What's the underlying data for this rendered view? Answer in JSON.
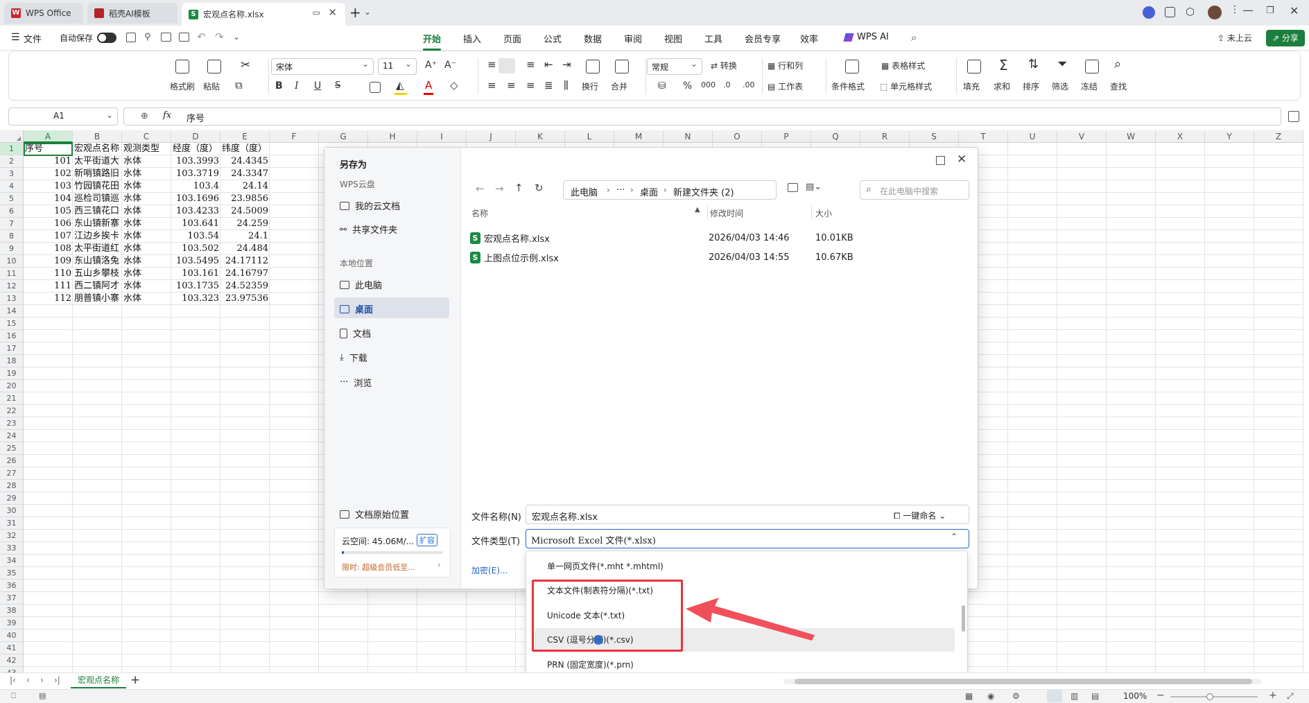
{
  "tabs": [
    {
      "label": "WPS Office",
      "color": "#c8262c"
    },
    {
      "label": "稻壳AI模板",
      "color": "#b6232a"
    },
    {
      "label": "宏观点名称.xlsx",
      "color": "#1a8a43"
    }
  ],
  "menubar": {
    "file": "文件",
    "autosave": "自动保存",
    "items": [
      "开始",
      "插入",
      "页面",
      "公式",
      "数据",
      "审阅",
      "视图",
      "工具",
      "会员专享",
      "效率",
      "WPS AI"
    ],
    "active": "开始",
    "cloud": "未上云",
    "share": "分享"
  },
  "ribbon": {
    "format_painter": "格式刷",
    "paste": "粘贴",
    "font": "宋体",
    "font_size": "11",
    "bold": "B",
    "italic": "I",
    "underline": "U",
    "wrap": "换行",
    "merge": "合并",
    "number_format": "常规",
    "convert": "转换",
    "rows_cols": "行和列",
    "worksheet": "工作表",
    "table_style": "表格样式",
    "cond_format": "条件格式",
    "cell_style": "单元格样式",
    "fill": "填充",
    "sum": "求和",
    "sort": "排序",
    "filter": "筛选",
    "freeze": "冻结",
    "find": "查找",
    "percent": "%"
  },
  "formula_bar": {
    "name_box": "A1",
    "fx": "fx",
    "value": "序号"
  },
  "columns": [
    "A",
    "B",
    "C",
    "D",
    "E",
    "F",
    "G",
    "H",
    "I",
    "J",
    "K",
    "L",
    "M",
    "N",
    "O",
    "P",
    "Q",
    "R",
    "S",
    "T",
    "U",
    "V",
    "W",
    "X",
    "Y",
    "Z"
  ],
  "rows": [
    "1",
    "2",
    "3",
    "4",
    "5",
    "6",
    "7",
    "8",
    "9",
    "10",
    "11",
    "12",
    "13",
    "14",
    "15",
    "16",
    "17",
    "18",
    "19",
    "20",
    "21",
    "22",
    "23",
    "24",
    "25",
    "26",
    "27",
    "28",
    "29",
    "30",
    "31",
    "32",
    "33",
    "34",
    "35",
    "36",
    "37",
    "38",
    "39",
    "40",
    "41",
    "42",
    "43"
  ],
  "sheet": {
    "header": [
      "序号",
      "宏观点名称",
      "观测类型",
      "经度（度）",
      "纬度（度）"
    ],
    "data": [
      [
        "101",
        "太平街道大",
        "水体",
        "103.3993",
        "24.4345"
      ],
      [
        "102",
        "新哨镇路旧",
        "水体",
        "103.3719",
        "24.3347"
      ],
      [
        "103",
        "竹园镇花田",
        "水体",
        "103.4",
        "24.14"
      ],
      [
        "104",
        "巡检司镇巡",
        "水体",
        "103.1696",
        "23.9856"
      ],
      [
        "105",
        "西三镇花口",
        "水体",
        "103.4233",
        "24.5009"
      ],
      [
        "106",
        "东山镇新寨",
        "水体",
        "103.641",
        "24.259"
      ],
      [
        "107",
        "江边乡挨卡",
        "水体",
        "103.54",
        "24.1"
      ],
      [
        "108",
        "太平街道红",
        "水体",
        "103.502",
        "24.484"
      ],
      [
        "109",
        "东山镇洛兔",
        "水体",
        "103.5495",
        "24.17112"
      ],
      [
        "110",
        "五山乡攀枝",
        "水体",
        "103.161",
        "24.16797"
      ],
      [
        "111",
        "西二镇阿才",
        "水体",
        "103.1735",
        "24.52359"
      ],
      [
        "112",
        "朋普镇小寨",
        "水体",
        "103.323",
        "23.97536"
      ]
    ]
  },
  "dialog": {
    "title": "另存为",
    "wps_cloud": "WPS云盘",
    "my_cloud_docs": "我的云文档",
    "shared_folder": "共享文件夹",
    "local": "本地位置",
    "this_pc": "此电脑",
    "desktop": "桌面",
    "documents": "文档",
    "downloads": "下载",
    "browse": "浏览",
    "original_location": "文档原始位置",
    "cloud_space": "云空间: 45.06M/...",
    "expand": "扩容",
    "promo": "限时: 超级会员低至...",
    "cloud_usage": 0.02,
    "path": [
      "此电脑",
      "···",
      "桌面",
      "新建文件夹 (2)"
    ],
    "search_placeholder": "在此电脑中搜索",
    "col_name": "名称",
    "col_modified": "修改时间",
    "col_size": "大小",
    "files": [
      {
        "name": "宏观点名称.xlsx",
        "modified": "2026/04/03 14:46",
        "size": "10.01KB"
      },
      {
        "name": "上图点位示例.xlsx",
        "modified": "2026/04/03 14:55",
        "size": "10.67KB"
      }
    ],
    "filename_label": "文件名称(N)",
    "filename_value": "宏观点名称.xlsx",
    "one_click_rename": "一键命名",
    "filetype_label": "文件类型(T)",
    "filetype_value": "Microsoft Excel 文件(*.xlsx)",
    "encrypt": "加密(E)...",
    "type_options": [
      "单一网页文件(*.mht *.mhtml)",
      "文本文件(制表符分隔)(*.txt)",
      "Unicode 文本(*.txt)",
      "CSV (逗号分隔)(*.csv)",
      "PRN (固定宽度)(*.prn)"
    ]
  },
  "sheet_tab": "宏观点名称",
  "status": {
    "zoom": "100%"
  },
  "colors": {
    "accent": "#1a7f3c",
    "highlight_box": "#e8343b",
    "arrow": "#f0505a"
  }
}
